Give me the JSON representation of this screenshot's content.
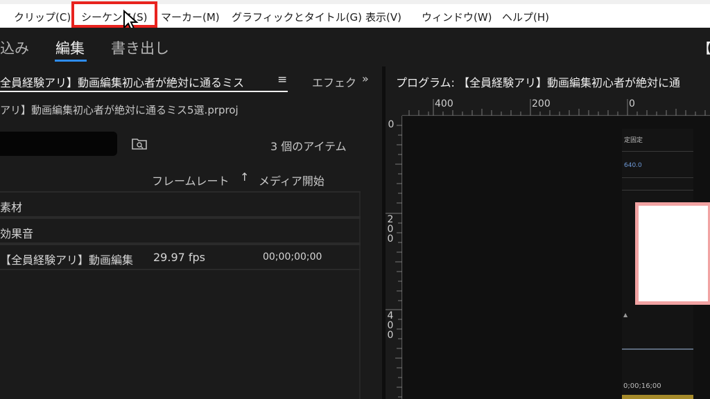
{
  "menu": {
    "items": [
      {
        "label": "クリップ(C)"
      },
      {
        "label": "シーケンス(S)"
      },
      {
        "label": "マーカー(M)"
      },
      {
        "label": "グラフィックとタイトル(G)"
      },
      {
        "label": "表示(V)"
      },
      {
        "label": "ウィンドウ(W)"
      },
      {
        "label": "ヘルプ(H)"
      }
    ],
    "highlight_color": "#e8231f"
  },
  "workspace": {
    "tabs": [
      {
        "label": "込み"
      },
      {
        "label": "編集"
      },
      {
        "label": "書き出し"
      }
    ],
    "active": "編集",
    "right_partial": "【全",
    "accent": "#2e8cf0"
  },
  "project_panel": {
    "tab_label": "全員経験アリ】動画編集初心者が絶対に通るミス",
    "menu_icon": "≡",
    "effects_tab": "エフェクト",
    "overflow": "»",
    "filename": "アリ】動画編集初心者が絶対に通るミス5選.prproj",
    "item_count": "3 個のアイテム",
    "columns": {
      "frame_rate": "フレームレート",
      "sort_arrow": "↑",
      "media_start": "メディア開始"
    },
    "rows": [
      {
        "name": "素材",
        "fps": "",
        "start": ""
      },
      {
        "name": "効果音",
        "fps": "",
        "start": ""
      },
      {
        "name": "【全員経験アリ】動画編集",
        "fps": "29.97 fps",
        "start": "00;00;00;00"
      }
    ]
  },
  "program_monitor": {
    "title": "プログラム: 【全員経験アリ】動画編集初心者が絶対に通",
    "ruler_h": [
      "400",
      "200",
      "0"
    ],
    "ruler_v": [
      "0",
      "200",
      "400"
    ],
    "frame": {
      "label1": "定固定",
      "label2": "640.0",
      "timecode": "0;00;16;00"
    }
  }
}
